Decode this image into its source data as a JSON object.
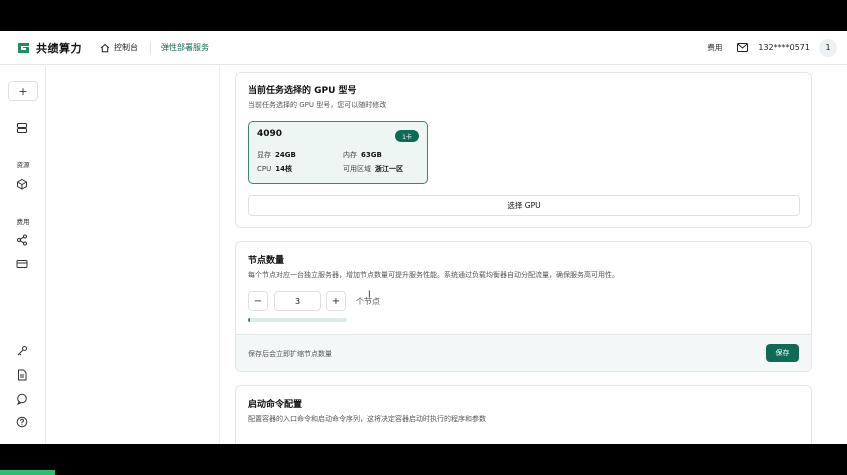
{
  "header": {
    "brand": "共绩算力",
    "nav_home": "控制台",
    "nav_active": "弹性部署服务",
    "fee": "费用",
    "phone": "132****0571",
    "avatar": "1",
    "accent_color": "#0f6b55"
  },
  "sidebar": {
    "add_label": "+",
    "section_resources": "资源",
    "section_fees": "费用",
    "icons": [
      "plus-icon",
      "server-icon",
      "cube-icon",
      "share-icon",
      "card-icon",
      "key-icon",
      "document-icon",
      "chat-icon",
      "help-icon"
    ]
  },
  "gpu_section": {
    "title": "当前任务选择的 GPU 型号",
    "desc": "当前任务选择的 GPU 型号，您可以随时修改",
    "gpu": {
      "name": "4090",
      "badge": "1卡",
      "vram_label": "显存",
      "vram_value": "24GB",
      "mem_label": "内存",
      "mem_value": "63GB",
      "cpu_label": "CPU",
      "cpu_value": "14核",
      "region_label": "可用区域",
      "region_value": "浙江一区"
    },
    "select_button": "选择 GPU"
  },
  "nodes_section": {
    "title": "节点数量",
    "desc": "每个节点对应一台独立服务器，增加节点数量可提升服务性能。系统通过负载均衡器自动分配流量，确保服务高可用性。",
    "minus": "−",
    "value": "3",
    "plus": "+",
    "unit": "个节点",
    "progress_fraction": 0.02,
    "footer_text": "保存后会立即扩缩节点数量",
    "save_button": "保存"
  },
  "startup_section": {
    "title": "启动命令配置",
    "desc": "配置容器的入口命令和启动命令序列，这将决定容器启动时执行的程序和参数"
  }
}
